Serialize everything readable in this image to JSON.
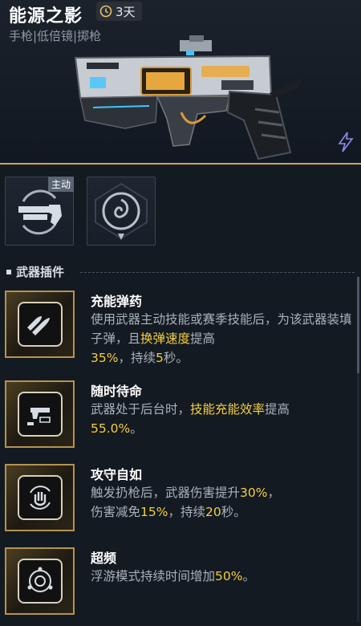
{
  "header": {
    "title": "能源之影",
    "duration": "3天",
    "tags": "手枪|低倍镜|掷枪"
  },
  "slots": {
    "active_tag": "主动"
  },
  "section": {
    "title": "武器插件"
  },
  "attachments": [
    {
      "name": "充能弹药",
      "desc_parts": [
        "使用武器主动技能或赛季技能后，为该武器装填子弹，且",
        "换弹速度",
        "提高",
        "35%",
        "，持续",
        "5",
        "秒。"
      ]
    },
    {
      "name": "随时待命",
      "desc_parts": [
        "武器处于后台时，",
        "技能充能效率",
        "提高",
        "55.0%",
        "。"
      ]
    },
    {
      "name": "攻守自如",
      "desc_parts": [
        "触发扔枪后，武器伤害提升",
        "30%",
        "，伤害减免",
        "15%",
        "，持续",
        "20",
        "秒。"
      ]
    },
    {
      "name": "超频",
      "desc_parts": [
        "浮游模式持续时间增加",
        "50%",
        "。"
      ]
    }
  ],
  "colors": {
    "highlight": "#f2cf3f",
    "gold_border": "#b59350",
    "background": "#141a22"
  }
}
